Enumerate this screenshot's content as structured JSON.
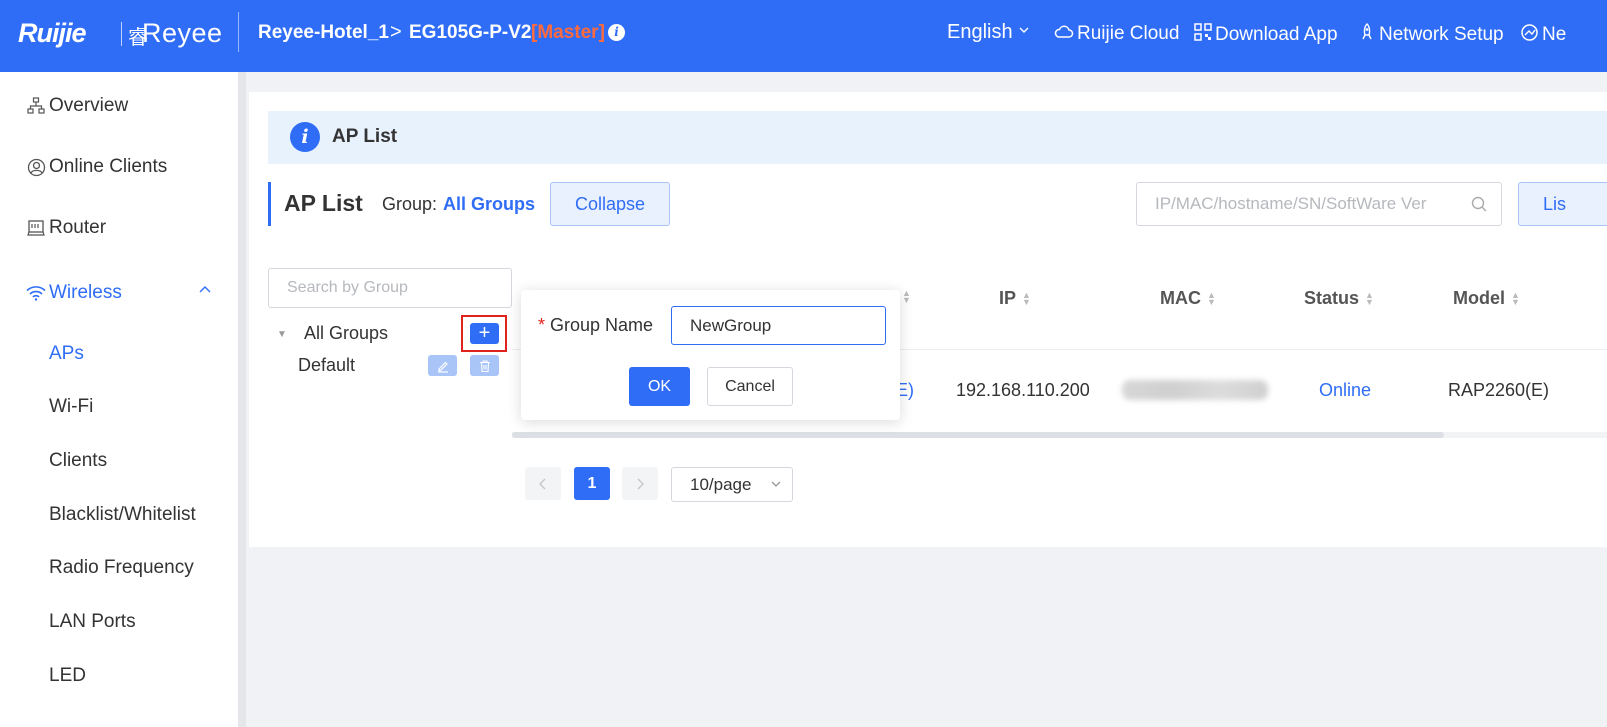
{
  "header": {
    "logo_ruijie": "Ruijie",
    "logo_reyee": "Reyee",
    "site": "Reyee-Hotel_1",
    "crumb_sep": ">",
    "device": "EG105G-P-V2",
    "role": "[Master]",
    "language": "English",
    "links": {
      "cloud": "Ruijie Cloud",
      "download": "Download App",
      "network_setup": "Network Setup",
      "network_partial": "Ne"
    },
    "colors": {
      "bar": "#2f6df6",
      "master": "#ff6a3d"
    }
  },
  "sidebar": {
    "items": {
      "overview": "Overview",
      "online_clients": "Online Clients",
      "router": "Router",
      "wireless": "Wireless"
    },
    "wireless_sub": {
      "aps": "APs",
      "wifi": "Wi-Fi",
      "clients": "Clients",
      "blacklist": "Blacklist/Whitelist",
      "radio": "Radio Frequency",
      "lan_ports": "LAN Ports",
      "led": "LED"
    }
  },
  "banner": {
    "title": "AP List"
  },
  "toolbar": {
    "page_title": "AP List",
    "group_label": "Group:",
    "group_value": "All Groups",
    "collapse": "Collapse",
    "search_placeholder": "IP/MAC/hostname/SN/SoftWare Ver",
    "list_button_partial": "Lis"
  },
  "group_tree": {
    "search_placeholder": "Search by Group",
    "all_groups": "All Groups",
    "default": "Default"
  },
  "table": {
    "headers": {
      "ip": "IP",
      "mac": "MAC",
      "status": "Status",
      "model": "Model"
    },
    "row": {
      "partial_name": "E)",
      "ip": "192.168.110.200",
      "status": "Online",
      "model": "RAP2260(E)"
    }
  },
  "pagination": {
    "current": "1",
    "page_size": "10/page"
  },
  "popover": {
    "required_mark": "*",
    "label": "Group Name",
    "value": "NewGroup",
    "ok": "OK",
    "cancel": "Cancel"
  }
}
